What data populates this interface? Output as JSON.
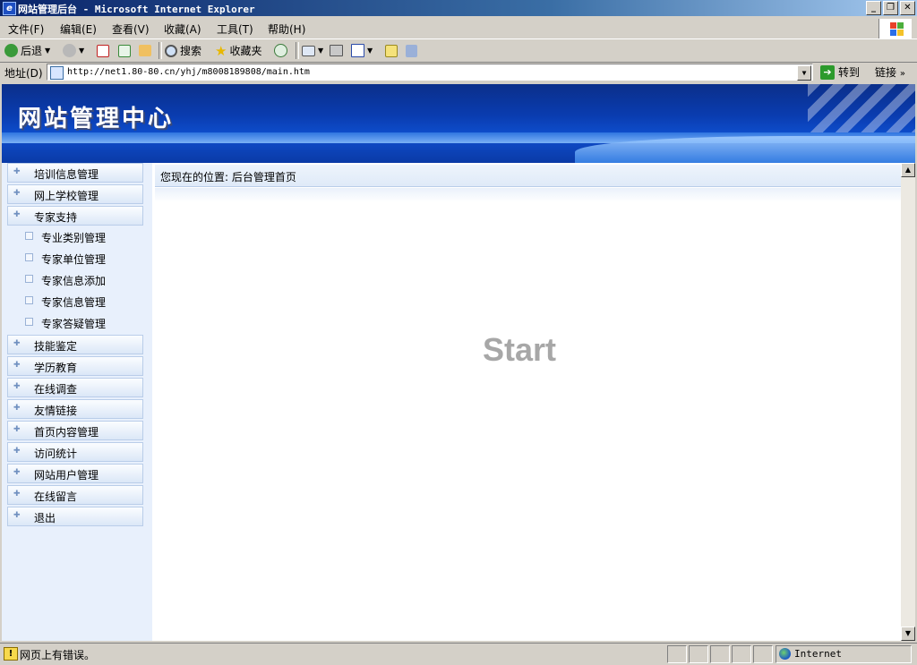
{
  "window": {
    "title": "网站管理后台 - Microsoft Internet Explorer",
    "minimize": "_",
    "maximize": "❐",
    "close": "✕"
  },
  "menu": [
    "文件(F)",
    "编辑(E)",
    "查看(V)",
    "收藏(A)",
    "工具(T)",
    "帮助(H)"
  ],
  "toolbar": {
    "back": "后退",
    "search": "搜索",
    "favorites": "收藏夹"
  },
  "address": {
    "label": "地址(D)",
    "url": "http://net1.80-80.cn/yhj/m8008189808/main.htm",
    "go": "转到",
    "links": "链接"
  },
  "banner": {
    "title": "网站管理中心"
  },
  "sidebar": {
    "items_top": [
      "培训信息管理",
      "网上学校管理",
      "专家支持"
    ],
    "sub_items": [
      "专业类别管理",
      "专家单位管理",
      "专家信息添加",
      "专家信息管理",
      "专家答疑管理"
    ],
    "items_bottom": [
      "技能鉴定",
      "学历教育",
      "在线调查",
      "友情链接",
      "首页内容管理",
      "访问统计",
      "网站用户管理",
      "在线留言",
      "退出"
    ]
  },
  "main": {
    "breadcrumb": "您现在的位置: 后台管理首页",
    "placeholder_text": "Start"
  },
  "status": {
    "message": "网页上有错误。",
    "zone": "Internet"
  }
}
